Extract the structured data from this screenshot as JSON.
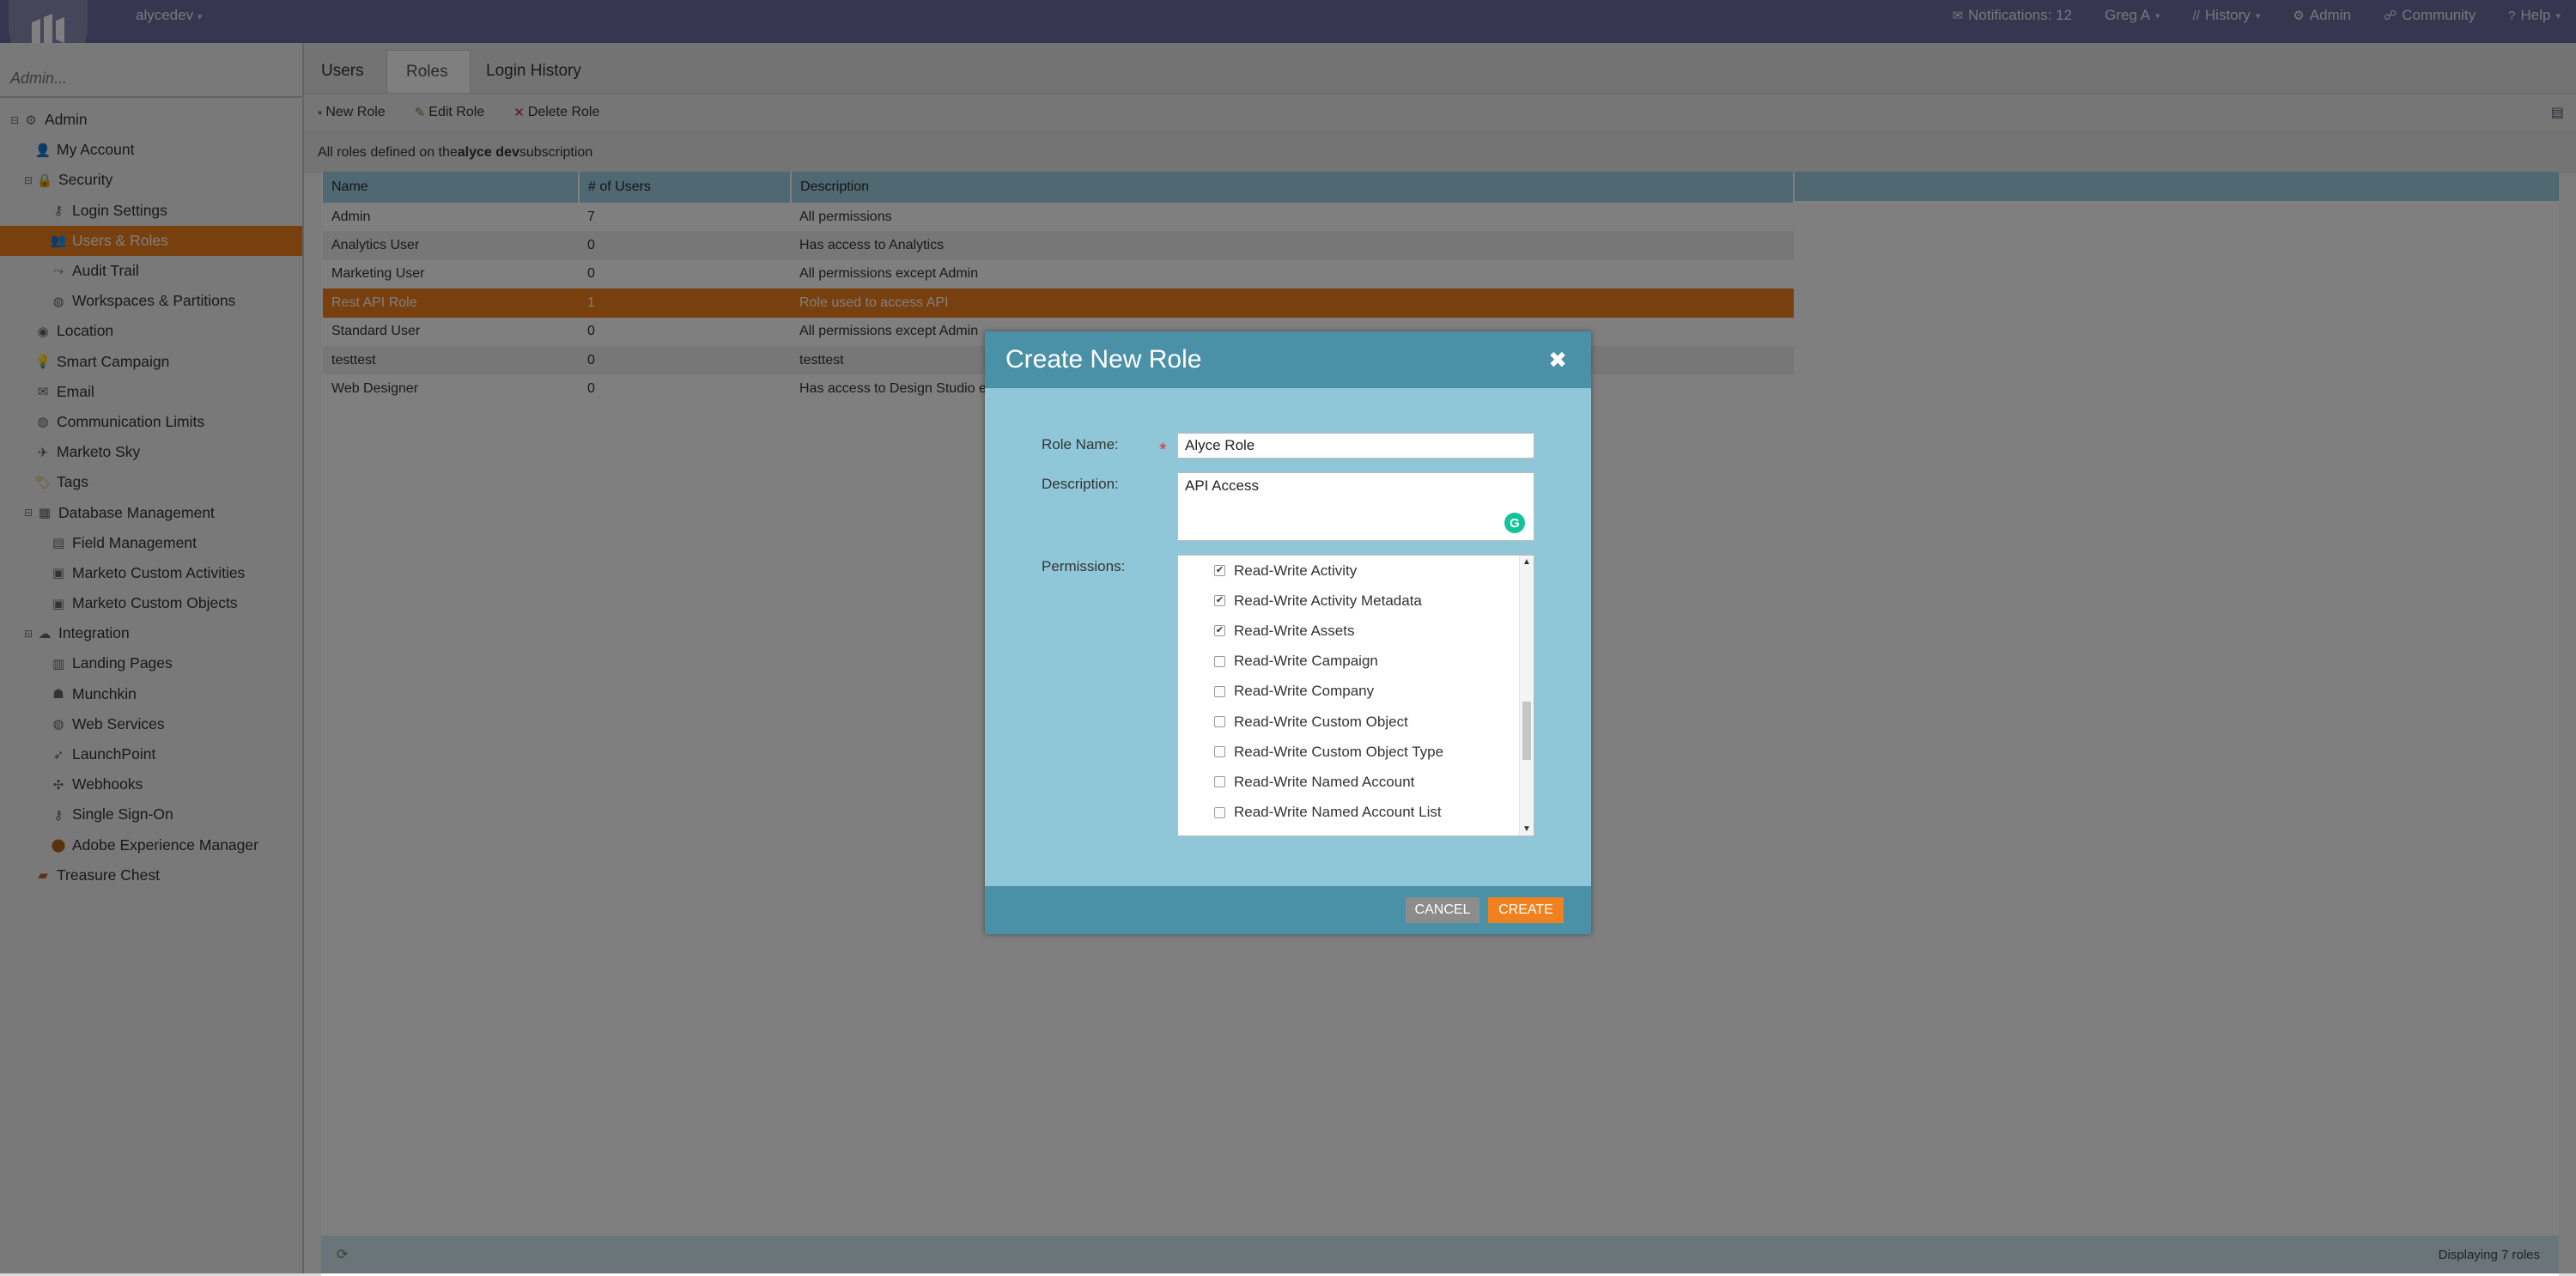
{
  "topbar": {
    "instance": "alycedev",
    "notifications": "Notifications: 12",
    "user": "Greg A",
    "history": "History",
    "admin": "Admin",
    "community": "Community",
    "help": "Help"
  },
  "sidebar": {
    "search_placeholder": "Admin...",
    "items": [
      {
        "label": "Admin",
        "icon": "gear-icon",
        "exp": "⊟"
      },
      {
        "label": "My Account",
        "icon": "user-icon",
        "exp": ""
      },
      {
        "label": "Security",
        "icon": "lock-icon",
        "exp": "⊟"
      },
      {
        "label": "Login Settings",
        "icon": "key-icon",
        "exp": ""
      },
      {
        "label": "Users & Roles",
        "icon": "users-icon",
        "exp": ""
      },
      {
        "label": "Audit Trail",
        "icon": "trail-icon",
        "exp": ""
      },
      {
        "label": "Workspaces & Partitions",
        "icon": "globe-icon",
        "exp": ""
      },
      {
        "label": "Location",
        "icon": "location-icon",
        "exp": ""
      },
      {
        "label": "Smart Campaign",
        "icon": "lightbulb-icon",
        "exp": ""
      },
      {
        "label": "Email",
        "icon": "email-icon",
        "exp": ""
      },
      {
        "label": "Communication Limits",
        "icon": "globe-icon",
        "exp": ""
      },
      {
        "label": "Marketo Sky",
        "icon": "plane-icon",
        "exp": ""
      },
      {
        "label": "Tags",
        "icon": "tag-icon",
        "exp": ""
      },
      {
        "label": "Database Management",
        "icon": "database-icon",
        "exp": "⊟"
      },
      {
        "label": "Field Management",
        "icon": "field-icon",
        "exp": ""
      },
      {
        "label": "Marketo Custom Activities",
        "icon": "activity-icon",
        "exp": ""
      },
      {
        "label": "Marketo Custom Objects",
        "icon": "object-icon",
        "exp": ""
      },
      {
        "label": "Integration",
        "icon": "cloud-icon",
        "exp": "⊟"
      },
      {
        "label": "Landing Pages",
        "icon": "page-icon",
        "exp": ""
      },
      {
        "label": "Munchkin",
        "icon": "munchkin-icon",
        "exp": ""
      },
      {
        "label": "Web Services",
        "icon": "globe-icon",
        "exp": ""
      },
      {
        "label": "LaunchPoint",
        "icon": "rocket-icon",
        "exp": ""
      },
      {
        "label": "Webhooks",
        "icon": "webhook-icon",
        "exp": ""
      },
      {
        "label": "Single Sign-On",
        "icon": "key-icon",
        "exp": ""
      },
      {
        "label": "Adobe Experience Manager",
        "icon": "adobe-icon",
        "exp": ""
      },
      {
        "label": "Treasure Chest",
        "icon": "chest-icon",
        "exp": ""
      }
    ]
  },
  "tabs": {
    "users": "Users",
    "roles": "Roles",
    "login_history": "Login History"
  },
  "toolbar": {
    "new_role": "New Role",
    "edit_role": "Edit Role",
    "delete_role": "Delete Role"
  },
  "subtitle": {
    "prefix": "All roles defined on the ",
    "subscription": "alyce dev",
    "suffix": " subscription"
  },
  "table": {
    "columns": [
      "Name",
      "# of Users",
      "Description"
    ],
    "rows": [
      {
        "name": "Admin",
        "users": "7",
        "desc": "All permissions"
      },
      {
        "name": "Analytics User",
        "users": "0",
        "desc": "Has access to Analytics"
      },
      {
        "name": "Marketing User",
        "users": "0",
        "desc": "All permissions except Admin"
      },
      {
        "name": "Rest API Role",
        "users": "1",
        "desc": "Role used to access API"
      },
      {
        "name": "Standard User",
        "users": "0",
        "desc": "All permissions except Admin"
      },
      {
        "name": "testtest",
        "users": "0",
        "desc": "testtest"
      },
      {
        "name": "Web Designer",
        "users": "0",
        "desc": "Has access to Design Studio except"
      }
    ]
  },
  "status": {
    "displaying": "Displaying 7 roles"
  },
  "modal": {
    "title": "Create New Role",
    "close": "✖",
    "role_name_label": "Role Name:",
    "role_name_value": "Alyce Role",
    "description_label": "Description:",
    "description_value": "API Access",
    "permissions_label": "Permissions:",
    "permissions": [
      {
        "label": "Read-Write Activity",
        "checked": true
      },
      {
        "label": "Read-Write Activity Metadata",
        "checked": true
      },
      {
        "label": "Read-Write Assets",
        "checked": true
      },
      {
        "label": "Read-Write Campaign",
        "checked": false
      },
      {
        "label": "Read-Write Company",
        "checked": false
      },
      {
        "label": "Read-Write Custom Object",
        "checked": false
      },
      {
        "label": "Read-Write Custom Object Type",
        "checked": false
      },
      {
        "label": "Read-Write Named Account",
        "checked": false
      },
      {
        "label": "Read-Write Named Account List",
        "checked": false
      }
    ],
    "cancel_label": "CANCEL",
    "create_label": "CREATE"
  },
  "colors": {
    "accent": "#f0811f",
    "topbar": "#6f6a9e",
    "modal_header": "#4a91a8",
    "modal_body": "#8fc7d8",
    "table_header": "#9ed0e3"
  }
}
